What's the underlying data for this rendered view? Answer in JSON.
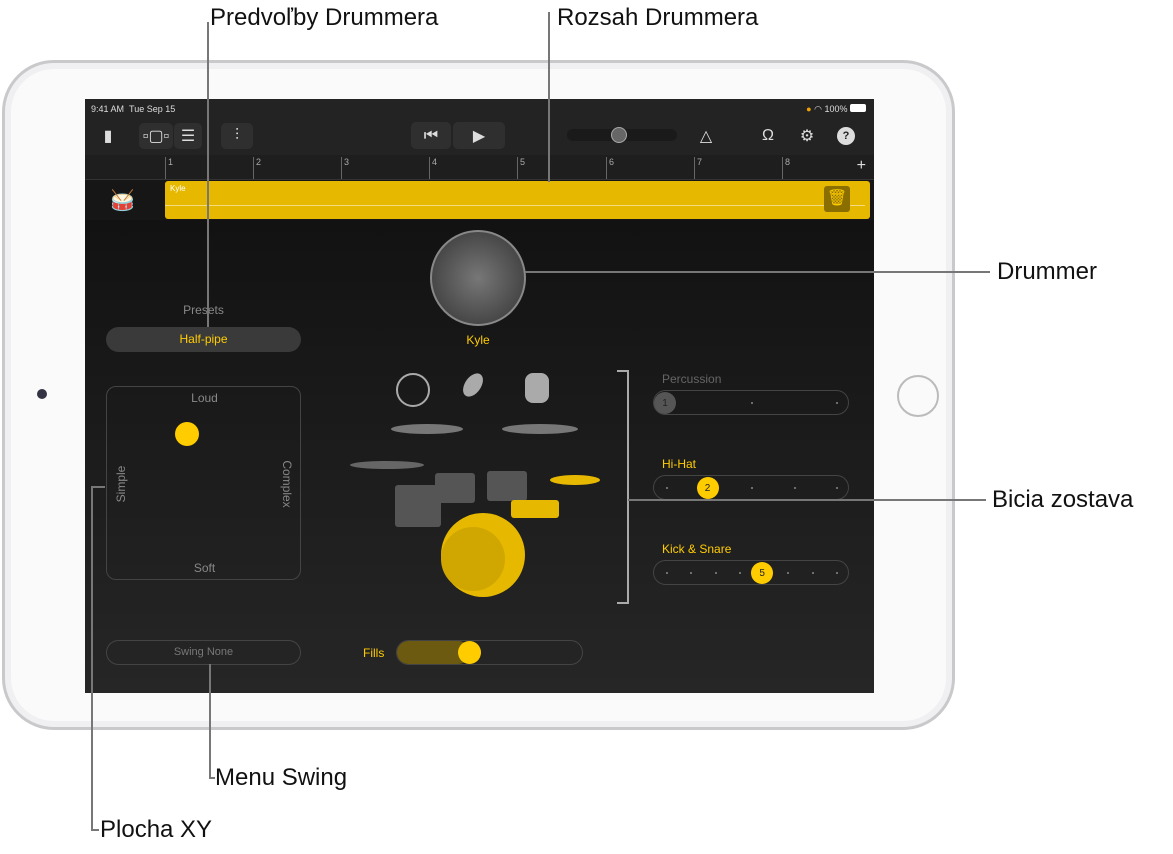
{
  "callouts": {
    "presets": "Predvoľby Drummera",
    "range": "Rozsah Drummera",
    "drummer": "Drummer",
    "kit": "Bicia zostava",
    "swing": "Menu Swing",
    "xy": "Plocha XY"
  },
  "status": {
    "time": "9:41 AM",
    "date": "Tue Sep 15",
    "battery": "100%"
  },
  "ruler": {
    "bars": [
      "1",
      "2",
      "3",
      "4",
      "5",
      "6",
      "7",
      "8"
    ],
    "add": "+"
  },
  "track": {
    "region_name": "Kyle"
  },
  "drummer": {
    "name": "Kyle"
  },
  "presets": {
    "label": "Presets",
    "value": "Half-pipe"
  },
  "xy_pad": {
    "top": "Loud",
    "bottom": "Soft",
    "left": "Simple",
    "right": "Complex",
    "complexity": 0.41,
    "loudness": 0.76
  },
  "kit_sliders": [
    {
      "label": "Percussion",
      "value": "1",
      "positions": 3,
      "index": 0,
      "active": false
    },
    {
      "label": "Hi-Hat",
      "value": "2",
      "positions": 5,
      "index": 1,
      "active": true
    },
    {
      "label": "Kick & Snare",
      "value": "5",
      "positions": 8,
      "index": 4,
      "active": true
    }
  ],
  "swing": {
    "label": "Swing None"
  },
  "fills": {
    "label": "Fills",
    "level": 0.37
  },
  "colors": {
    "accent": "#ffcc00",
    "region": "#e6b800"
  }
}
